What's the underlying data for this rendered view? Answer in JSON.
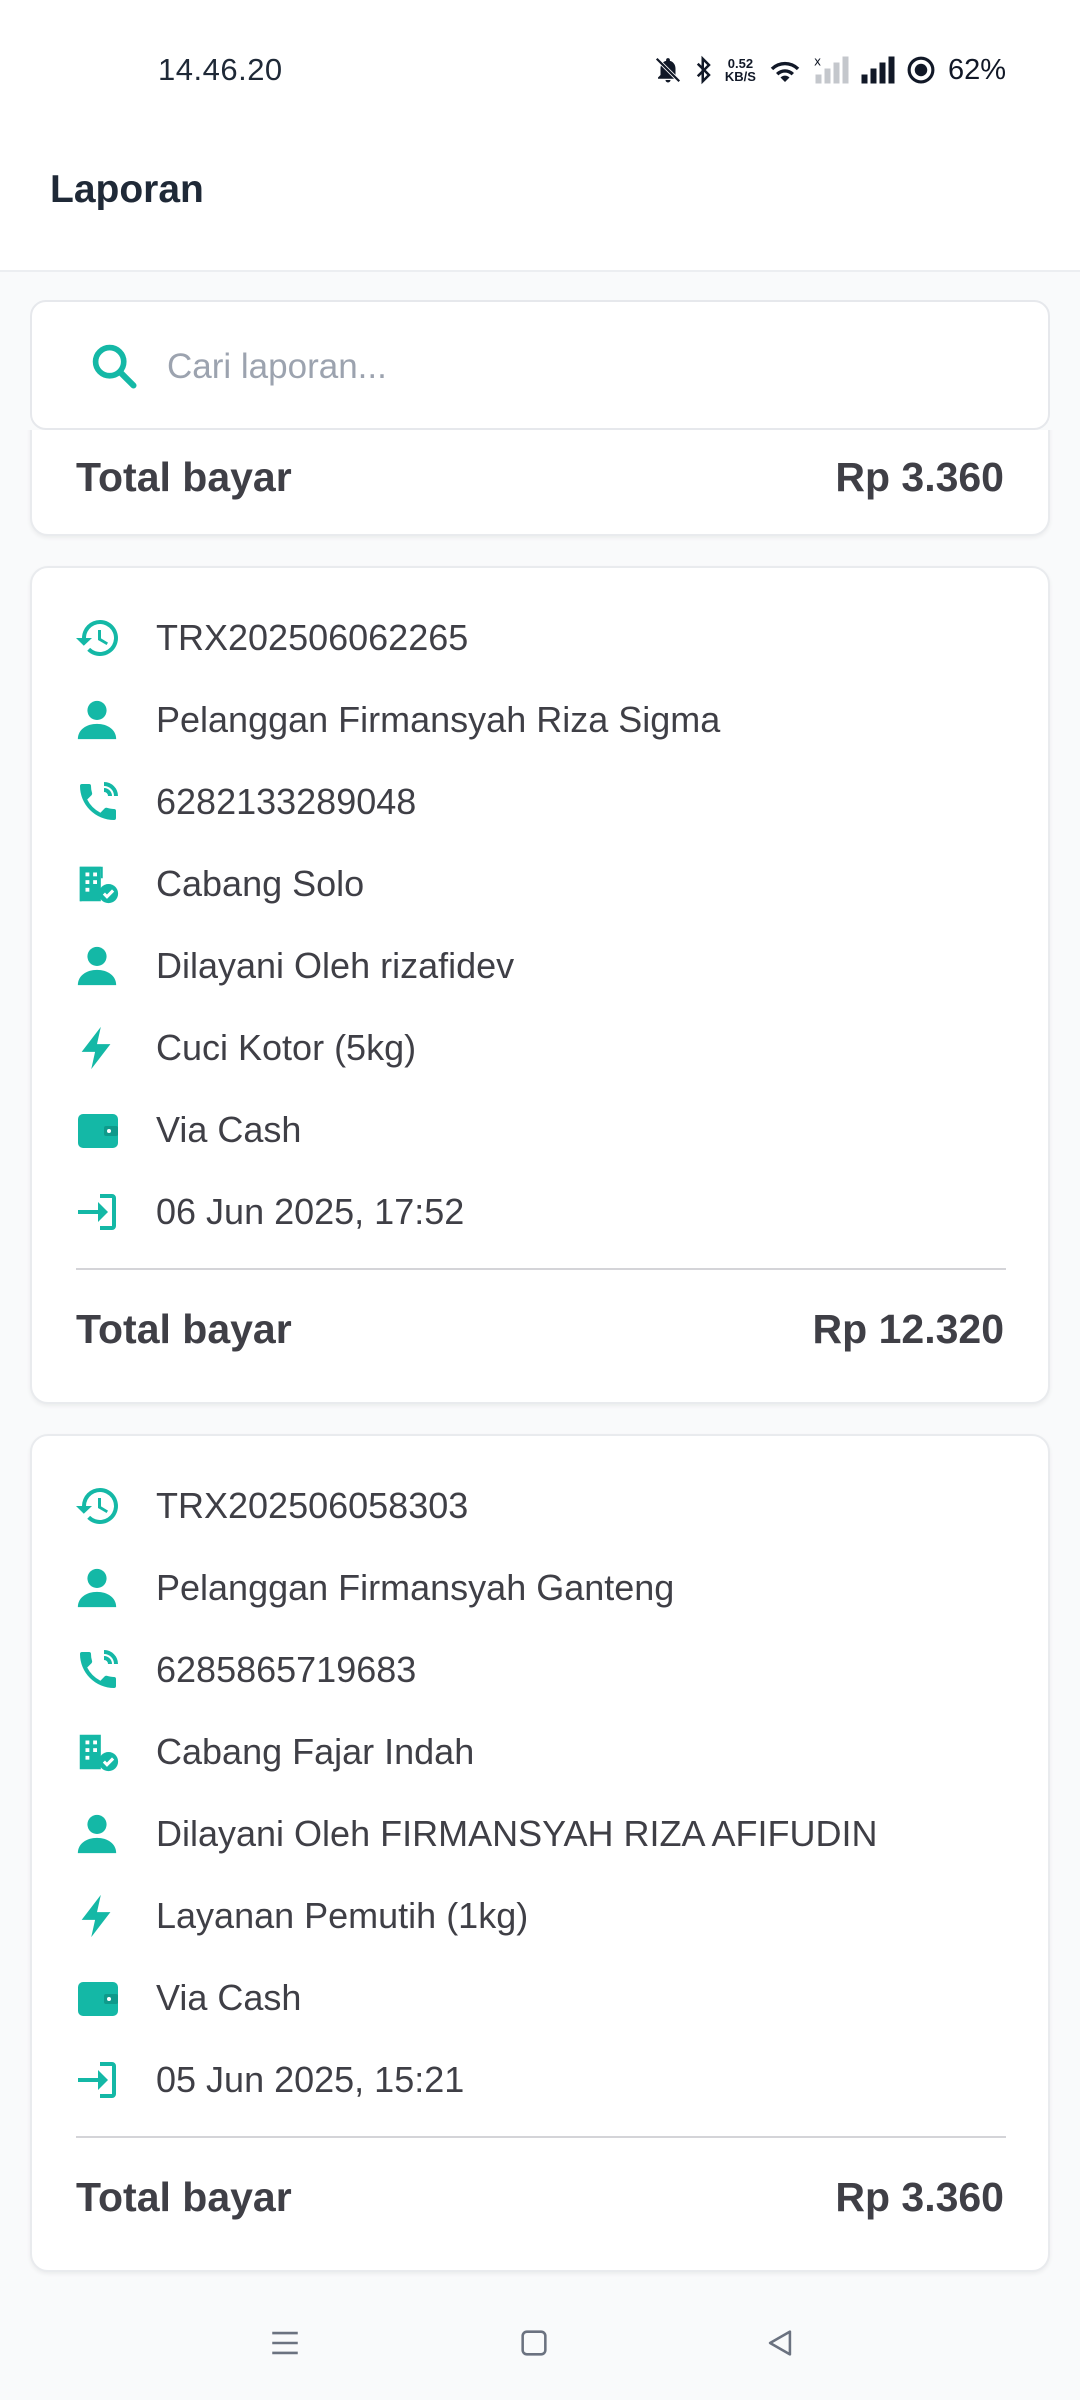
{
  "status_bar": {
    "time": "14.46.20",
    "net_speed_value": "0.52",
    "net_speed_unit": "KB/S",
    "battery": "62%"
  },
  "header": {
    "title": "Laporan"
  },
  "search": {
    "placeholder": "Cari laporan..."
  },
  "colors": {
    "accent": "#14b8a6",
    "text": "#3f3f46"
  },
  "partial_card": {
    "total_label": "Total bayar",
    "total_value": "Rp 3.360"
  },
  "transactions": [
    {
      "id": "TRX202506062265",
      "customer": "Pelanggan Firmansyah Riza Sigma",
      "phone": "6282133289048",
      "branch": "Cabang Solo",
      "served_by": "Dilayani Oleh rizafidev",
      "service": "Cuci Kotor (5kg)",
      "payment": "Via Cash",
      "date": "06 Jun 2025, 17:52",
      "total_label": "Total bayar",
      "total_value": "Rp 12.320"
    },
    {
      "id": "TRX202506058303",
      "customer": "Pelanggan Firmansyah Ganteng",
      "phone": "6285865719683",
      "branch": "Cabang Fajar Indah",
      "served_by": "Dilayani Oleh FIRMANSYAH RIZA AFIFUDIN",
      "service": "Layanan Pemutih (1kg)",
      "payment": "Via Cash",
      "date": "05 Jun 2025, 15:21",
      "total_label": "Total bayar",
      "total_value": "Rp 3.360"
    }
  ],
  "icons": [
    "history-icon",
    "person-icon",
    "phone-icon",
    "branch-icon",
    "bolt-icon",
    "wallet-icon",
    "login-icon",
    "search-icon"
  ],
  "nav": [
    "menu-icon",
    "home-icon",
    "back-icon"
  ]
}
